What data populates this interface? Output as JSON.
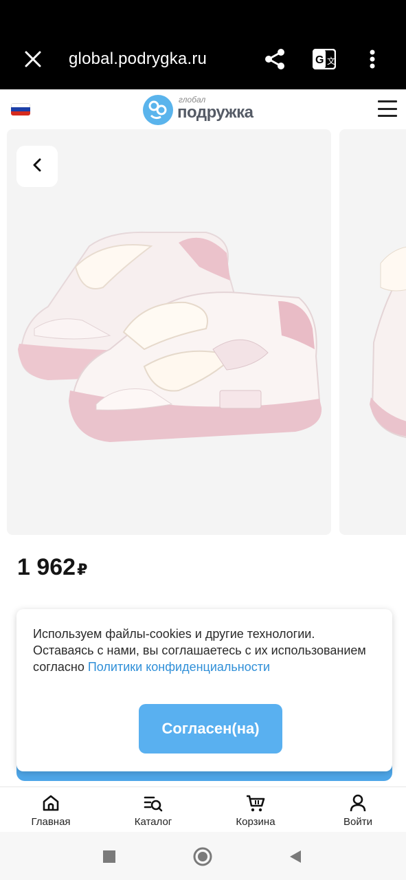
{
  "browser": {
    "url": "global.podrygka.ru",
    "icons": {
      "close": "close-icon",
      "share": "share-icon",
      "translate": "translate-icon",
      "more": "more-vert-icon"
    }
  },
  "header": {
    "logo_small": "глобал",
    "logo_big": "подружка",
    "flag_colors": [
      "#ffffff",
      "#1c3fa8",
      "#d52b1e"
    ]
  },
  "gallery": {
    "back_icon": "chevron-left-icon",
    "image": "pink-white-sneakers-image"
  },
  "product": {
    "price": "1 962",
    "currency": "₽"
  },
  "cookie": {
    "text": "Используем файлы-cookies и другие технологии. Оставаясь с нами, вы соглашаетесь с их использованием согласно ",
    "link": "Политики конфиденциальности",
    "accept": "Согласен(на)"
  },
  "bottom_nav": {
    "items": [
      {
        "label": "Главная",
        "icon": "home-icon"
      },
      {
        "label": "Каталог",
        "icon": "catalog-search-icon"
      },
      {
        "label": "Корзина",
        "icon": "cart-icon"
      },
      {
        "label": "Войти",
        "icon": "user-icon"
      }
    ]
  },
  "colors": {
    "accent": "#59b0f0",
    "link": "#2f8fd8",
    "logo": "#5ab4ec"
  }
}
